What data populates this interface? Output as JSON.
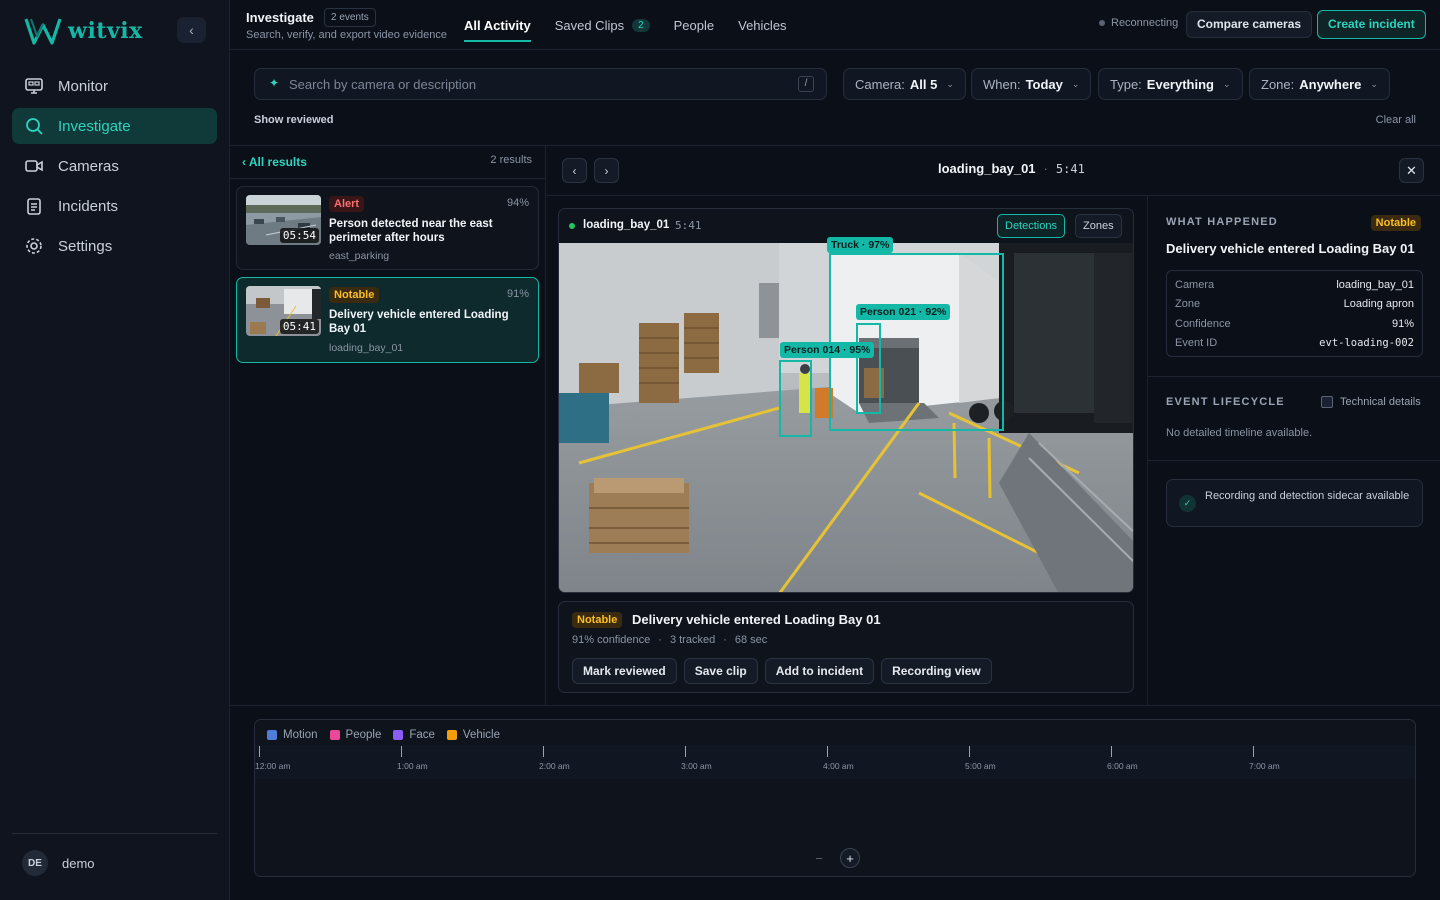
{
  "brand": {
    "name": "witvix"
  },
  "sidebar": {
    "items": [
      {
        "label": "Monitor",
        "icon": "monitor-icon"
      },
      {
        "label": "Investigate",
        "icon": "search-icon"
      },
      {
        "label": "Cameras",
        "icon": "video-camera-icon"
      },
      {
        "label": "Incidents",
        "icon": "clipboard-icon"
      },
      {
        "label": "Settings",
        "icon": "gear-icon"
      }
    ],
    "active": "Investigate",
    "user": {
      "initials": "DE",
      "name": "demo"
    }
  },
  "header": {
    "title": "Investigate",
    "events_badge": "2 events",
    "subtitle": "Search, verify, and export video evidence",
    "tabs": [
      {
        "label": "All Activity"
      },
      {
        "label": "Saved Clips",
        "count": "2"
      },
      {
        "label": "People"
      },
      {
        "label": "Vehicles"
      }
    ],
    "status": "Reconnecting",
    "compare_label": "Compare cameras",
    "create_label": "Create incident"
  },
  "filters": {
    "search_placeholder": "Search by camera or description",
    "search_shortcut": "/",
    "camera": {
      "key": "Camera:",
      "value": "All 5"
    },
    "when": {
      "key": "When:",
      "value": "Today"
    },
    "type": {
      "key": "Type:",
      "value": "Everything"
    },
    "zone": {
      "key": "Zone:",
      "value": "Anywhere"
    },
    "show_reviewed": "Show reviewed",
    "clear_all": "Clear all"
  },
  "results": {
    "back_label": "All results",
    "count": "2 results",
    "items": [
      {
        "severity": "Alert",
        "confidence": "94%",
        "title": "Person detected near the east perimeter after hours",
        "camera": "east_parking",
        "time": "05:54"
      },
      {
        "severity": "Notable",
        "confidence": "91%",
        "title": "Delivery vehicle entered Loading Bay 01",
        "camera": "loading_bay_01",
        "time": "05:41"
      }
    ]
  },
  "detail": {
    "camera": "loading_bay_01",
    "separator": "·",
    "time": "5:41",
    "video": {
      "camera": "loading_bay_01",
      "time": "5:41",
      "detections_label": "Detections",
      "zones_label": "Zones",
      "boxes": [
        {
          "label": "Truck · 97%"
        },
        {
          "label": "Person 021 · 92%"
        },
        {
          "label": "Person 014 · 95%"
        }
      ]
    },
    "summary": {
      "severity": "Notable",
      "title": "Delivery vehicle entered Loading Bay 01",
      "confidence": "91% confidence",
      "tracked": "3 tracked",
      "duration": "68 sec",
      "actions": [
        "Mark reviewed",
        "Save clip",
        "Add to incident",
        "Recording view"
      ]
    }
  },
  "info": {
    "what_happened_label": "WHAT HAPPENED",
    "severity": "Notable",
    "title": "Delivery vehicle entered Loading Bay 01",
    "fields": [
      {
        "key": "Camera",
        "value": "loading_bay_01"
      },
      {
        "key": "Zone",
        "value": "Loading apron"
      },
      {
        "key": "Confidence",
        "value": "91%"
      },
      {
        "key": "Event ID",
        "value": "evt-loading-002"
      }
    ],
    "lifecycle_label": "EVENT LIFECYCLE",
    "technical_label": "Technical details",
    "no_timeline": "No detailed timeline available.",
    "sidecar": "Recording and detection sidecar available"
  },
  "timeline": {
    "legend": [
      {
        "label": "Motion",
        "color": "#4f7bd9"
      },
      {
        "label": "People",
        "color": "#ec4899"
      },
      {
        "label": "Face",
        "color": "#8b5cf6"
      },
      {
        "label": "Vehicle",
        "color": "#f59e0b"
      }
    ],
    "ticks": [
      "12:00 am",
      "1:00 am",
      "2:00 am",
      "3:00 am",
      "4:00 am",
      "5:00 am",
      "6:00 am",
      "7:00 am"
    ],
    "zoom_out": "−",
    "zoom_in": "+"
  },
  "colors": {
    "accent": "#14b8a6",
    "alert": "#f87171",
    "notable": "#fbbf24"
  }
}
